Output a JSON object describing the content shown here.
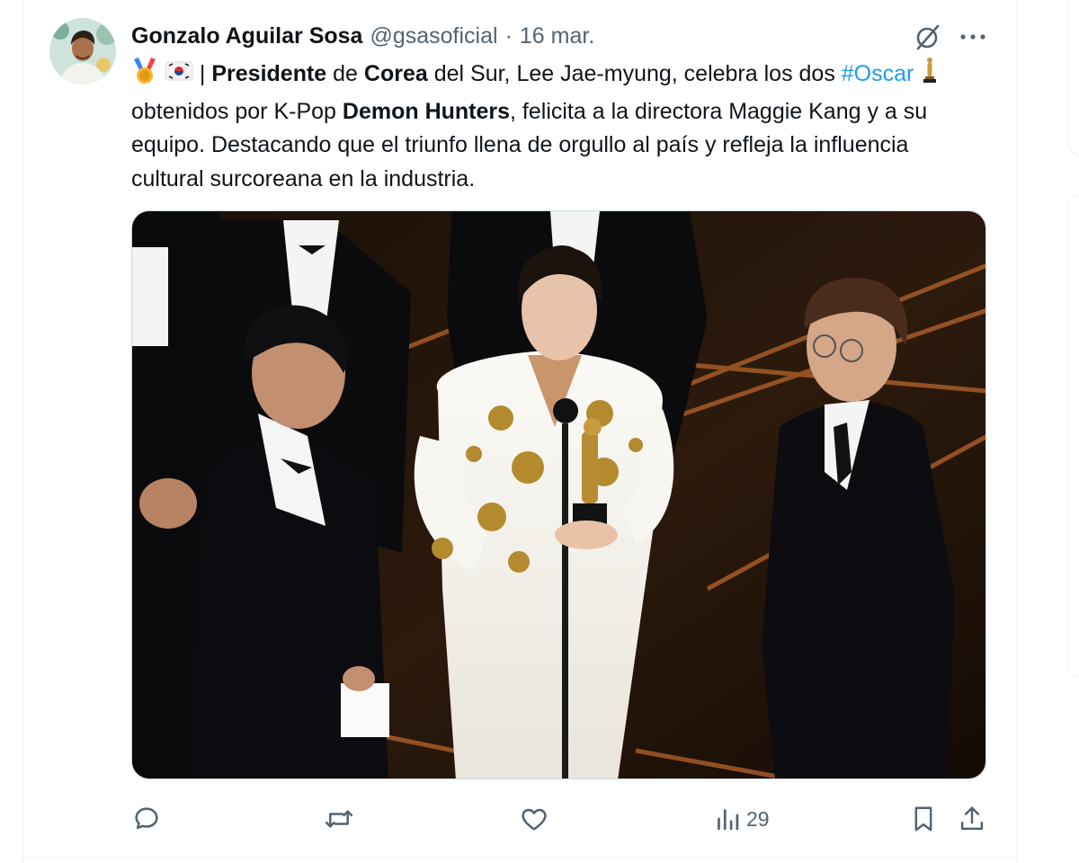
{
  "tweet": {
    "author": {
      "display_name": "Gonzalo Aguilar Sosa",
      "handle": "@gsasoficial",
      "separator": "·",
      "date": "16 mar."
    },
    "text": {
      "seg1": "| ",
      "seg2": "Presidente",
      "seg3": " de ",
      "seg4": "Corea",
      "seg5": " del Sur, Lee Jae-myung, celebra los dos ",
      "hashtag": "#Oscar",
      "seg6": " obtenidos por K-Pop ",
      "seg7": "Demon Hunters",
      "seg8": ", felicita a la directora Maggie Kang y a su equipo. Destacando que el triunfo llena de orgullo al país y refleja la influencia cultural surcoreana en la industria."
    },
    "emojis": [
      "medal-icon",
      "south-korea-flag-icon",
      "oscar-statuette-icon"
    ],
    "media": {
      "kind": "photo"
    },
    "actions": {
      "views_count": "29"
    }
  },
  "icons": {
    "header": [
      "grok-icon",
      "more-icon"
    ],
    "actions": [
      "reply-icon",
      "repost-icon",
      "like-icon",
      "views-icon",
      "bookmark-icon",
      "share-icon"
    ]
  },
  "colors": {
    "text": "#0f1419",
    "secondary": "#536471",
    "link": "#1d9bf0",
    "border": "#eff3f4"
  }
}
